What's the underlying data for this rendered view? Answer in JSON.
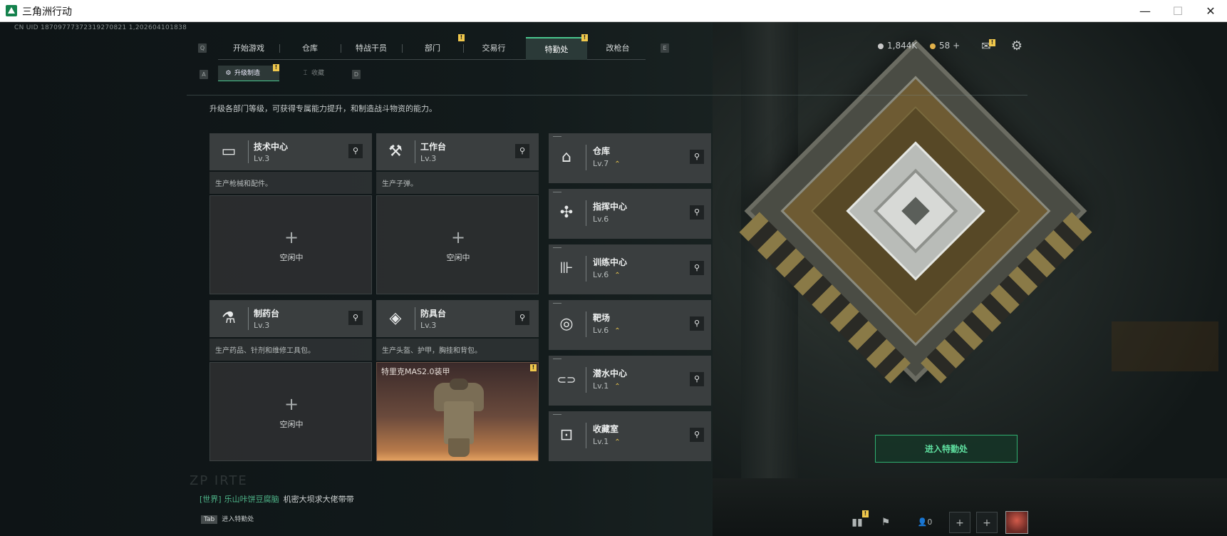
{
  "window": {
    "title": "三角洲行动",
    "minimize": "—",
    "maximize": "☐",
    "close": "✕"
  },
  "uid": "CN UID 18709777372319270821 1,202604101838",
  "nav": {
    "key_left": "Q",
    "key_right": "E",
    "tabs": [
      {
        "label": "开始游戏"
      },
      {
        "label": "仓库"
      },
      {
        "label": "特战干员"
      },
      {
        "label": "部门",
        "badge": "!"
      },
      {
        "label": "交易行"
      },
      {
        "label": "特勤处",
        "badge": "!",
        "active": true
      },
      {
        "label": "改枪台"
      }
    ]
  },
  "subnav": {
    "key_left": "A",
    "key_right": "D",
    "tabs": [
      {
        "label": "升级制造",
        "icon": "⚙",
        "badge": "!",
        "active": true
      },
      {
        "label": "收藏",
        "icon": "⌶"
      }
    ]
  },
  "description": "升级各部门等级，可获得专属能力提升，和制造战斗物资的能力。",
  "big_cards": [
    {
      "name": "技术中心",
      "level": "Lv.3",
      "desc": "生产枪械和配件。",
      "icon": "computer-icon",
      "glyph": "▭",
      "status": "空闲中",
      "plus": "+"
    },
    {
      "name": "工作台",
      "level": "Lv.3",
      "desc": "生产子弹。",
      "icon": "tools-icon",
      "glyph": "⚒",
      "status": "空闲中",
      "plus": "+"
    },
    {
      "name": "制药台",
      "level": "Lv.3",
      "desc": "生产药品、针剂和维修工具包。",
      "icon": "microscope-icon",
      "glyph": "⚗",
      "status": "空闲中",
      "plus": "+"
    },
    {
      "name": "防具台",
      "level": "Lv.3",
      "desc": "生产头盔、护甲，胸挂和背包。",
      "icon": "armor-blocks-icon",
      "glyph": "◈",
      "crafting": "特里克MAS2.0装甲",
      "badge": "!"
    }
  ],
  "small_cards": [
    {
      "name": "仓库",
      "level": "Lv.7",
      "upgrade": "⌃",
      "icon": "warehouse-icon",
      "glyph": "⌂"
    },
    {
      "name": "指挥中心",
      "level": "Lv.6",
      "upgrade": "",
      "icon": "chip-icon",
      "glyph": "✣"
    },
    {
      "name": "训练中心",
      "level": "Lv.6",
      "upgrade": "⌃",
      "icon": "dumbbell-icon",
      "glyph": "⊪"
    },
    {
      "name": "靶场",
      "level": "Lv.6",
      "upgrade": "⌃",
      "icon": "target-icon",
      "glyph": "◎"
    },
    {
      "name": "潜水中心",
      "level": "Lv.1",
      "upgrade": "⌃",
      "icon": "diving-mask-icon",
      "glyph": "⊂⊃"
    },
    {
      "name": "收藏室",
      "level": "Lv.1",
      "upgrade": "⌃",
      "icon": "collection-icon",
      "glyph": "⊡"
    }
  ],
  "search_glyph": "⚲",
  "currency": [
    {
      "value": "1,844K",
      "color": "#c9c9c9"
    },
    {
      "value": "58 +",
      "color": "#e2b14a"
    }
  ],
  "mail_badge": "!",
  "enter_button": "进入特勤处",
  "deco_text": "ZP IRTE",
  "chat": {
    "channel": "[世界]",
    "player": "乐山咔饼豆腐脑",
    "message": "机密大坝求大佬带带"
  },
  "bottom_hint": {
    "key": "Tab",
    "label": "进入特勤处"
  },
  "tray": {
    "badge": "!",
    "friends_count": "0",
    "plus": "+"
  },
  "accent_color": "#49c78e"
}
